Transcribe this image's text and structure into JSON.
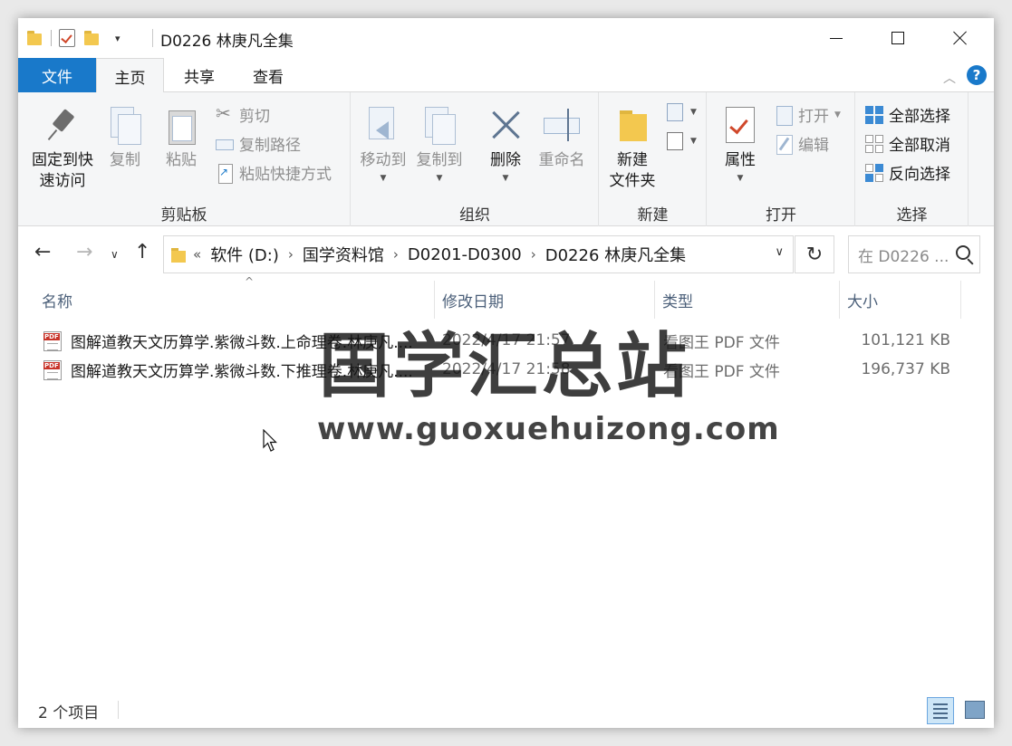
{
  "window": {
    "title": "D0226 林庚凡全集"
  },
  "tabs": [
    {
      "label": "文件"
    },
    {
      "label": "主页"
    },
    {
      "label": "共享"
    },
    {
      "label": "查看"
    }
  ],
  "ribbon": {
    "clipboard": {
      "label": "剪贴板",
      "pin": "固定到快\n速访问",
      "pin_line1": "固定到快",
      "pin_line2": "速访问",
      "copy": "复制",
      "paste": "粘贴",
      "cut": "剪切",
      "copy_path": "复制路径",
      "paste_shortcut": "粘贴快捷方式"
    },
    "organize": {
      "label": "组织",
      "move_to": "移动到",
      "copy_to": "复制到",
      "delete": "删除",
      "rename": "重命名"
    },
    "new": {
      "label": "新建",
      "new_folder_line1": "新建",
      "new_folder_line2": "文件夹"
    },
    "open": {
      "label": "打开",
      "properties": "属性",
      "open": "打开",
      "edit": "编辑"
    },
    "select": {
      "label": "选择",
      "select_all": "全部选择",
      "select_none": "全部取消",
      "invert": "反向选择"
    }
  },
  "address": {
    "overflow": "«",
    "crumbs": [
      "软件 (D:)",
      "国学资料馆",
      "D0201-D0300",
      "D0226 林庚凡全集"
    ]
  },
  "search": {
    "placeholder": "在 D0226 ..."
  },
  "columns": {
    "name": "名称",
    "date": "修改日期",
    "type": "类型",
    "size": "大小"
  },
  "files": [
    {
      "name": "图解道教天文历算学.紫微斗数.上命理卷.林庚凡....",
      "date": "2022/4/17 21:57",
      "type": "看图王 PDF 文件",
      "size": "101,121 KB"
    },
    {
      "name": "图解道教天文历算学.紫微斗数.下推理卷.林庚凡....",
      "date": "2022/4/17 21:58",
      "type": "看图王 PDF 文件",
      "size": "196,737 KB"
    }
  ],
  "watermark": {
    "title": "国学汇总站",
    "url": "www.guoxuehuizong.com"
  },
  "status": {
    "count": "2 个项目"
  },
  "colors": {
    "accent": "#1979ca",
    "folder": "#f3c84f"
  }
}
